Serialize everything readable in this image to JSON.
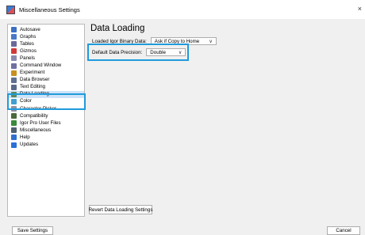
{
  "window": {
    "title": "Miscellaneous Settings",
    "close_glyph": "×"
  },
  "sidebar": {
    "items": [
      {
        "label": "Autosave",
        "icon": "autosave-icon",
        "color": "#3d6fc4"
      },
      {
        "label": "Graphs",
        "icon": "graphs-icon",
        "color": "#4a78c8"
      },
      {
        "label": "Tables",
        "icon": "tables-icon",
        "color": "#6a6a9a"
      },
      {
        "label": "Gizmos",
        "icon": "gizmos-icon",
        "color": "#d03a3a"
      },
      {
        "label": "Panels",
        "icon": "panels-icon",
        "color": "#8a8ab0"
      },
      {
        "label": "Command Window",
        "icon": "command-window-icon",
        "color": "#7070a0"
      },
      {
        "label": "Experiment",
        "icon": "experiment-icon",
        "color": "#c89020"
      },
      {
        "label": "Data Browser",
        "icon": "data-browser-icon",
        "color": "#607090"
      },
      {
        "label": "Text Editing",
        "icon": "text-editing-icon",
        "color": "#5a6a8a"
      },
      {
        "label": "Data Loading",
        "icon": "data-loading-icon",
        "color": "#5a8a5a"
      },
      {
        "label": "Color",
        "icon": "color-icon",
        "color": "#40a0d0"
      },
      {
        "label": "Character Picker",
        "icon": "character-picker-icon",
        "color": "#9090a0"
      },
      {
        "label": "Compatibility",
        "icon": "compatibility-icon",
        "color": "#4a6a3a"
      },
      {
        "label": "Igor Pro User Files",
        "icon": "user-files-icon",
        "color": "#3a8a3a"
      },
      {
        "label": "Miscellaneous",
        "icon": "miscellaneous-icon",
        "color": "#506070"
      },
      {
        "label": "Help",
        "icon": "help-icon",
        "color": "#2f6fd0"
      },
      {
        "label": "Updates",
        "icon": "updates-icon",
        "color": "#2a70d8"
      }
    ],
    "selected": "Data Loading"
  },
  "main": {
    "title": "Data Loading",
    "loaded_binary": {
      "label": "Loaded Igor Binary Data:",
      "value": "Ask if Copy to Home"
    },
    "precision": {
      "label": "Default Data Precision:",
      "value": "Double"
    },
    "revert_label": "Revert Data Loading Settings"
  },
  "footer": {
    "save_label": "Save Settings",
    "cancel_label": "Cancel"
  },
  "colors": {
    "highlight": "#1f9bdc",
    "selection": "#cfe3f8"
  }
}
